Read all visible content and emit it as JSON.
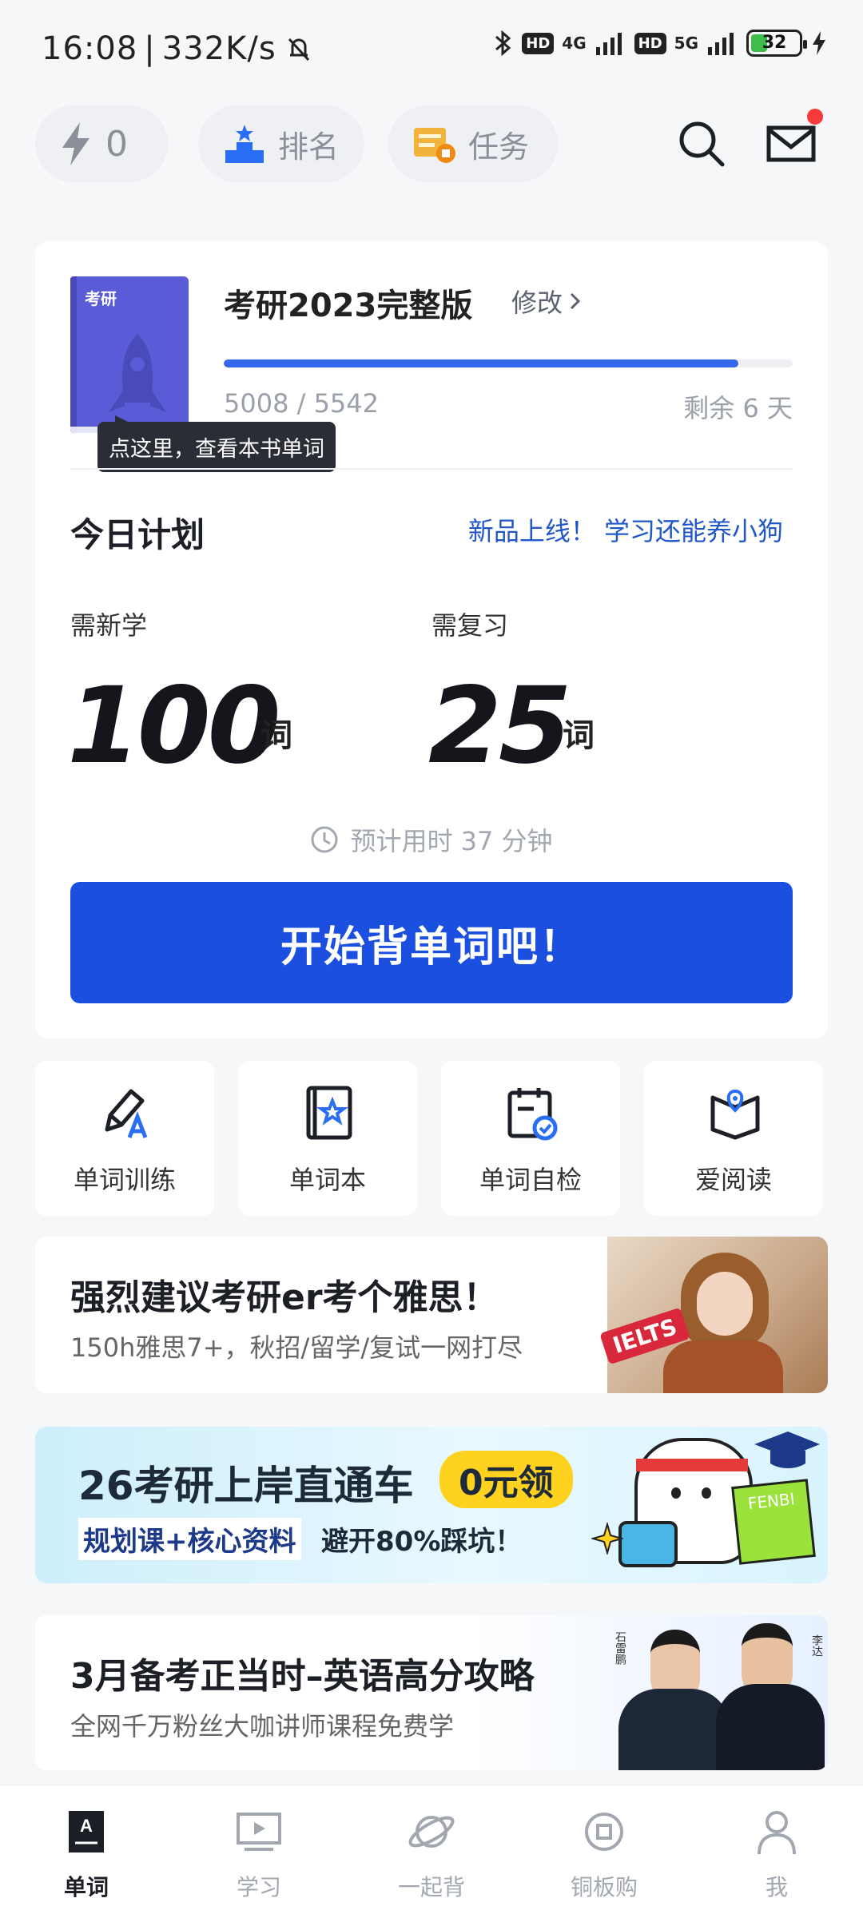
{
  "status_bar": {
    "time": "16:08",
    "net_speed": "332K/s",
    "hd1": "HD",
    "net1": "4G",
    "hd2": "HD",
    "net2": "5G",
    "battery": "32"
  },
  "top": {
    "energy_count": "0",
    "rank_label": "排名",
    "task_label": "任务"
  },
  "book": {
    "cover_title": "考研",
    "title": "考研2023完整版",
    "modify_label": "修改",
    "progress_text": "5008 / 5542",
    "progress_fraction": 0.904,
    "remaining_text": "剩余 6 天",
    "tooltip": "点这里，查看本书单词"
  },
  "plan": {
    "title": "今日计划",
    "promo": "新品上线！ 学习还能养小狗",
    "new_label": "需新学",
    "new_count": "100",
    "review_label": "需复习",
    "review_count": "25",
    "unit": "词",
    "estimate": "预计用时 37 分钟",
    "start_button": "开始背单词吧！"
  },
  "quick_actions": [
    {
      "label": "单词训练",
      "icon": "pencil-a-icon"
    },
    {
      "label": "单词本",
      "icon": "wordbook-star-icon"
    },
    {
      "label": "单词自检",
      "icon": "calendar-check-icon"
    },
    {
      "label": "爱阅读",
      "icon": "open-book-location-icon"
    }
  ],
  "banners": [
    {
      "title": "强烈建议考研er考个雅思！",
      "subtitle": "150h雅思7+，秋招/留学/复试一网打尽",
      "badge": "IELTS"
    },
    {
      "title": "26考研上岸直通车",
      "tag": "0元领",
      "sub1": "规划课+核心资料",
      "sub2": "避开80%踩坑！",
      "mascot_text": "FENBI"
    },
    {
      "title": "3月备考正当时–英语高分攻略",
      "subtitle": "全网千万粉丝大咖讲师课程免费学",
      "names": [
        "石雷鹏",
        "李达"
      ]
    }
  ],
  "nav": [
    {
      "label": "单词",
      "active": true
    },
    {
      "label": "学习",
      "active": false
    },
    {
      "label": "一起背",
      "active": false
    },
    {
      "label": "铜板购",
      "active": false
    },
    {
      "label": "我",
      "active": false
    }
  ],
  "colors": {
    "accent": "#1a4fe0",
    "progress": "#3566ee",
    "promo_text": "#2257c9",
    "notification_dot": "#f53b3b"
  }
}
